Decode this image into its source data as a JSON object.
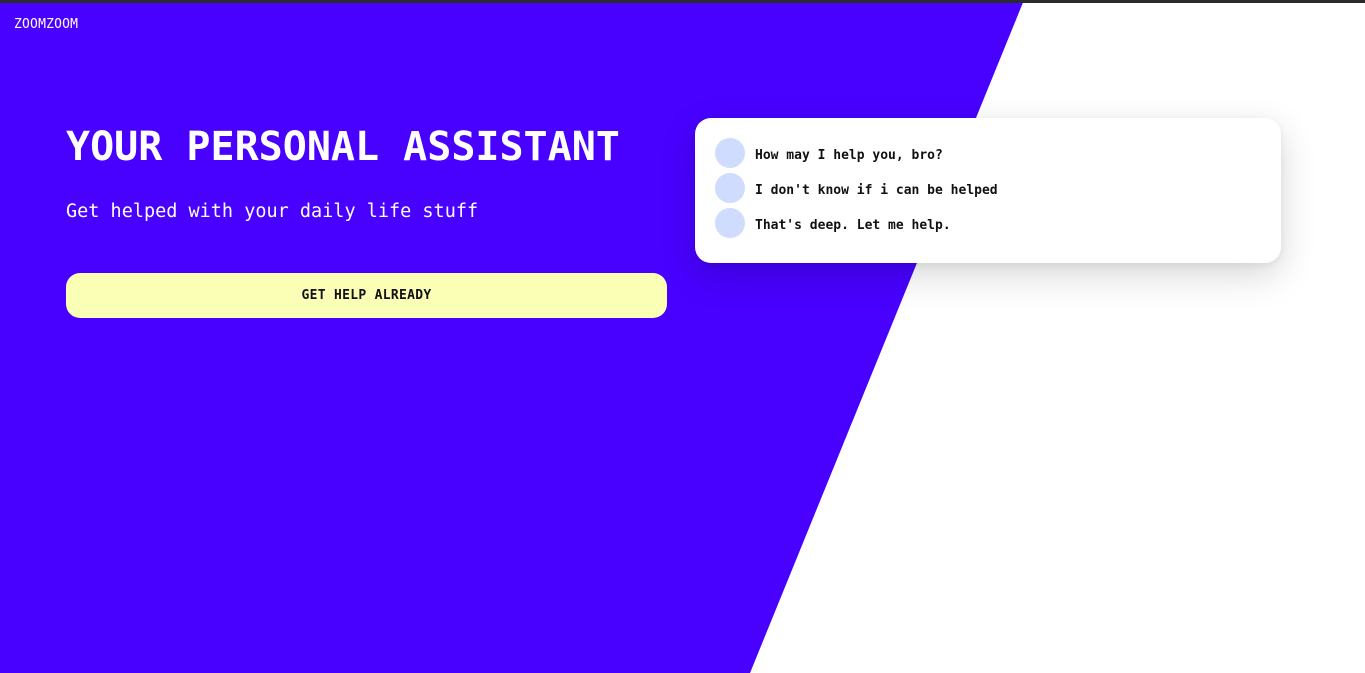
{
  "brand": {
    "name": "ZOOMZOOM"
  },
  "hero": {
    "title": "YOUR PERSONAL ASSISTANT",
    "subtitle": "Get helped with your daily life stuff",
    "cta_label": "GET HELP ALREADY"
  },
  "chat": {
    "messages": [
      {
        "text": "How may I help you, bro?",
        "avatar_icon": "avatar-placeholder-icon"
      },
      {
        "text": "I don't know if i can be helped",
        "avatar_icon": "avatar-placeholder-icon"
      },
      {
        "text": "That's deep. Let me help.",
        "avatar_icon": "avatar-placeholder-icon"
      }
    ]
  },
  "colors": {
    "hero_background": "#4800ff",
    "page_background": "#ffffff",
    "cta_background": "#fbffb6",
    "avatar": "#cfdcfd",
    "top_strip": "#2b2b2b"
  }
}
